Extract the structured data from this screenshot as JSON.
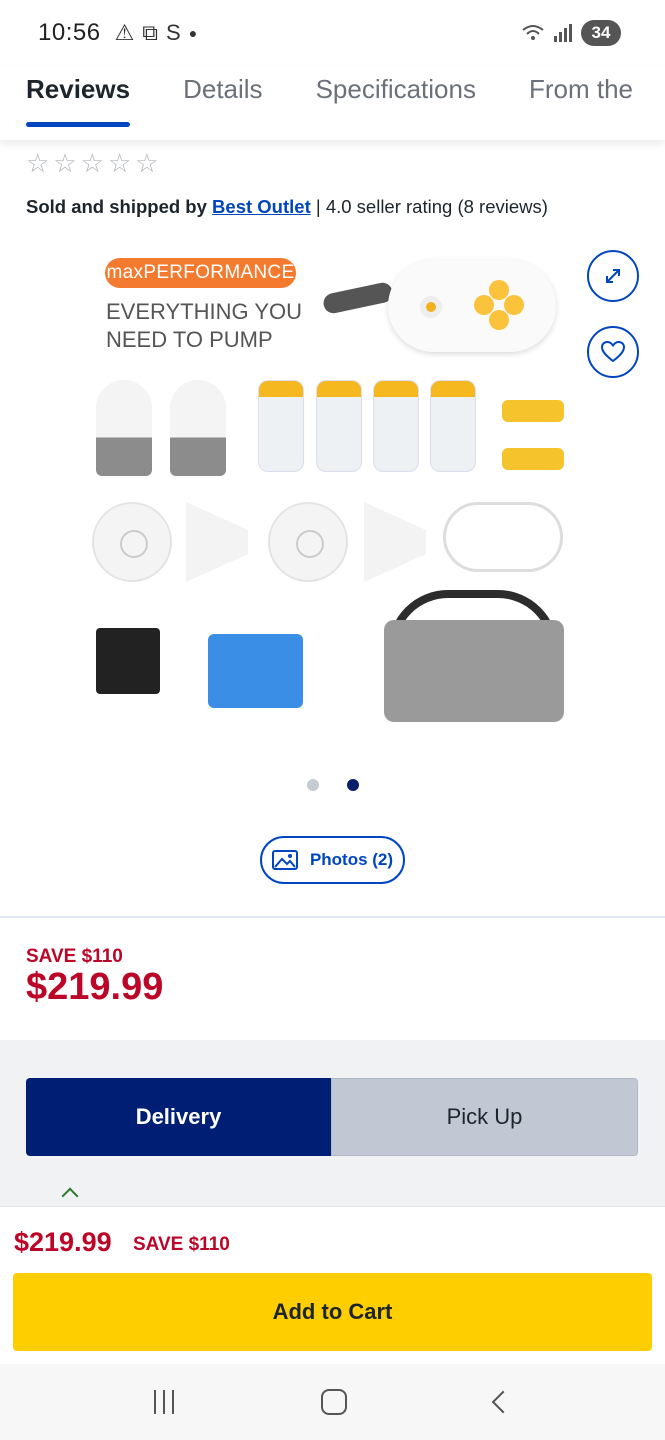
{
  "status_bar": {
    "time": "10:56",
    "battery": "34"
  },
  "tabs": [
    {
      "label": "Reviews",
      "active": true
    },
    {
      "label": "Details",
      "active": false
    },
    {
      "label": "Specifications",
      "active": false
    },
    {
      "label": "From the",
      "active": false
    }
  ],
  "rating": {
    "stars_filled": 0,
    "stars_total": 5
  },
  "seller": {
    "prefix": "Sold and shipped by",
    "name": "Best Outlet",
    "rating_text": "| 4.0 seller rating (8 reviews)"
  },
  "product_image": {
    "badge": "maxPERFORMANCE",
    "headline": "EVERYTHING YOU NEED TO PUMP",
    "expand_icon": "expand-icon",
    "wishlist_icon": "heart-icon"
  },
  "carousel": {
    "count": 2,
    "active_index": 1
  },
  "photos_button": {
    "label": "Photos (2)",
    "icon": "image-icon"
  },
  "pricing": {
    "save": "SAVE $110",
    "price": "$219.99"
  },
  "fulfillment": {
    "delivery_label": "Delivery",
    "pickup_label": "Pick Up",
    "selected": "delivery"
  },
  "sticky": {
    "price": "$219.99",
    "save": "SAVE $110",
    "add_to_cart": "Add to Cart"
  },
  "colors": {
    "accent": "#0046be",
    "sale_red": "#bb0628",
    "cart_yellow": "#ffce00",
    "delivery_navy": "#001e73"
  }
}
